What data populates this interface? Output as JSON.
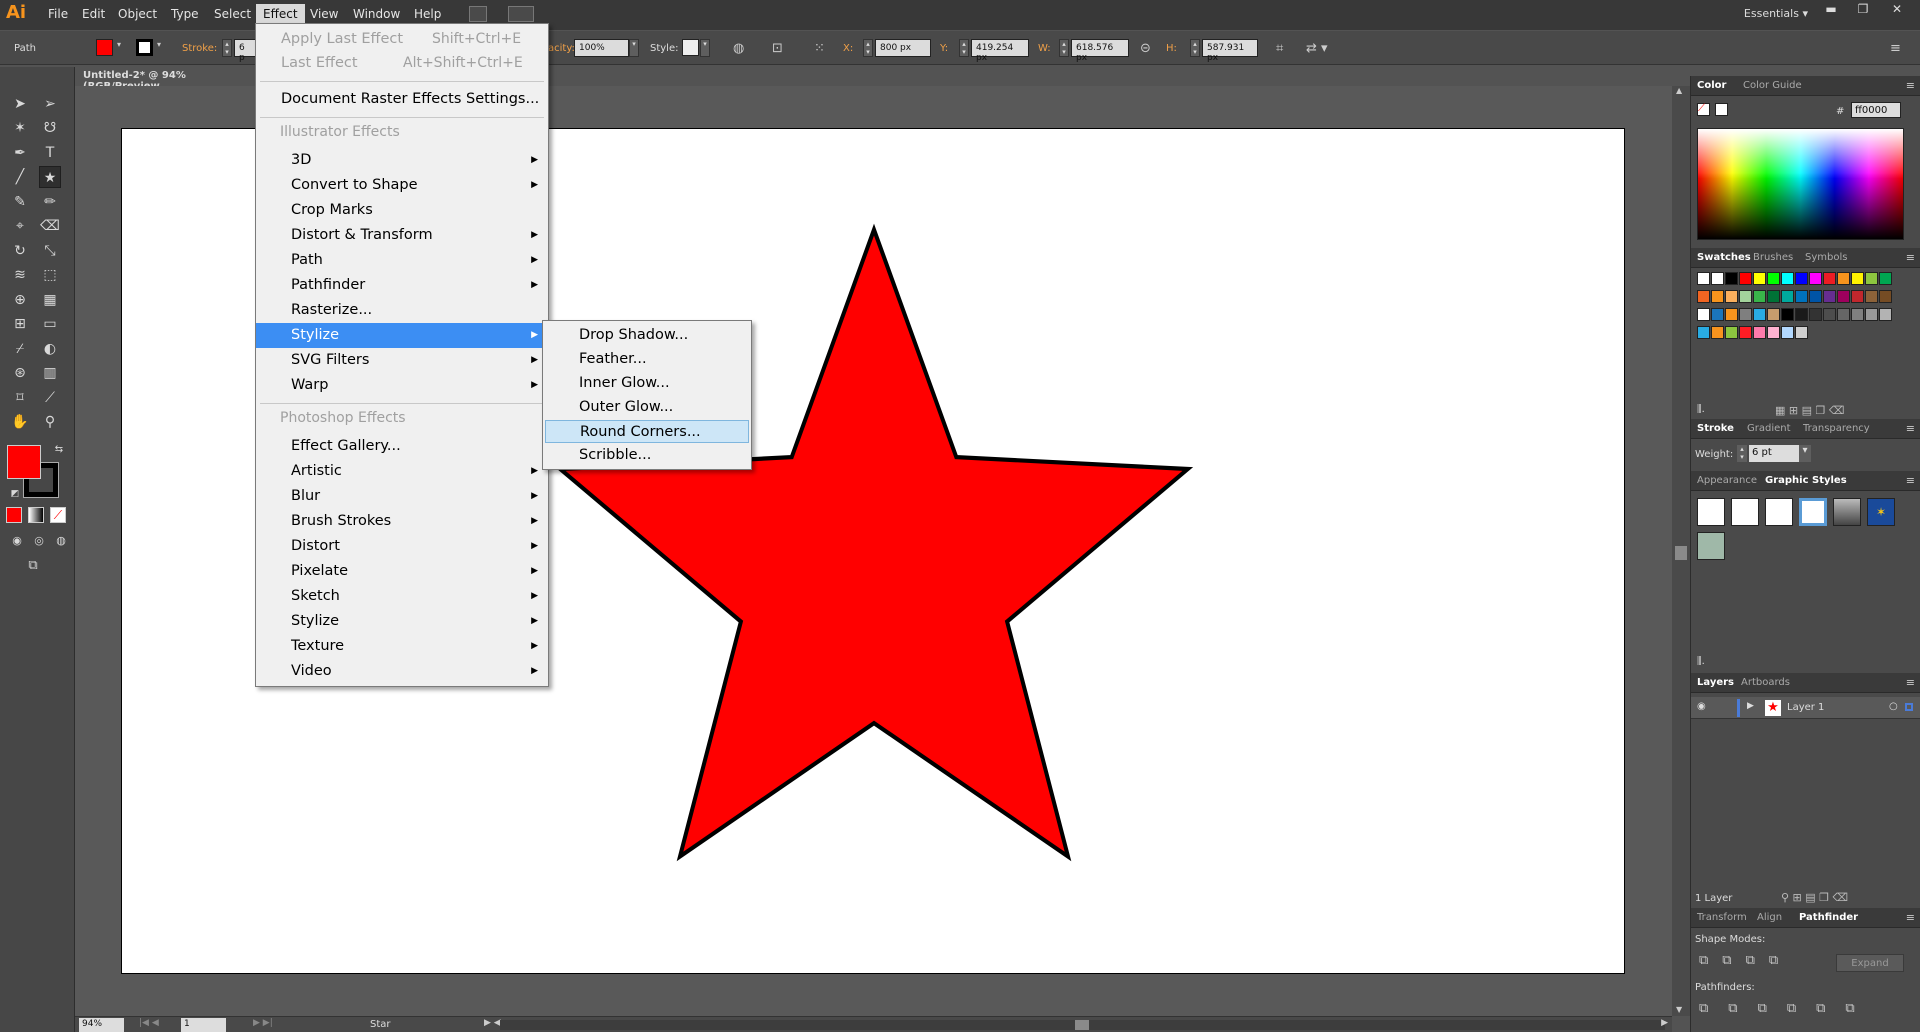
{
  "app": {
    "logo": "Ai",
    "workspace": "Essentials"
  },
  "menubar": [
    "File",
    "Edit",
    "Object",
    "Type",
    "Select",
    "Effect",
    "View",
    "Window",
    "Help"
  ],
  "control": {
    "selection_type": "Path",
    "stroke_label": "Stroke:",
    "stroke_value": "6 p",
    "opacity_label": "acity:",
    "opacity_value": "100%",
    "style_label": "Style:",
    "x_label": "X:",
    "x_value": "800 px",
    "y_label": "Y:",
    "y_value": "419.254 px",
    "w_label": "W:",
    "w_value": "618.576 px",
    "h_label": "H:",
    "h_value": "587.931 px"
  },
  "document": {
    "tab_title": "Untitled-2* @ 94% (RGB/Preview"
  },
  "effect_menu": {
    "items": [
      {
        "label": "Apply Last Effect",
        "shortcut": "Shift+Ctrl+E",
        "disabled": true
      },
      {
        "label": "Last Effect",
        "shortcut": "Alt+Shift+Ctrl+E",
        "disabled": true
      },
      {
        "label": "Document Raster Effects Settings..."
      }
    ],
    "illustrator_header": "Illustrator Effects",
    "illustrator_items": [
      "3D",
      "Convert to Shape",
      "Crop Marks",
      "Distort & Transform",
      "Path",
      "Pathfinder",
      "Rasterize...",
      "Stylize",
      "SVG Filters",
      "Warp"
    ],
    "photoshop_header": "Photoshop Effects",
    "photoshop_items": [
      "Effect Gallery...",
      "Artistic",
      "Blur",
      "Brush Strokes",
      "Distort",
      "Pixelate",
      "Sketch",
      "Stylize",
      "Texture",
      "Video"
    ]
  },
  "stylize_submenu": [
    "Drop Shadow...",
    "Feather...",
    "Inner Glow...",
    "Outer Glow...",
    "Round Corners...",
    "Scribble..."
  ],
  "panels": {
    "color_tabs": [
      "Color",
      "Color Guide"
    ],
    "hex_value": "ff0000",
    "swatch_tabs": [
      "Swatches",
      "Brushes",
      "Symbols"
    ],
    "stroke_tabs": [
      "Stroke",
      "Gradient",
      "Transparency"
    ],
    "weight_label": "Weight:",
    "weight_value": "6 pt",
    "appearance_tabs": [
      "Appearance",
      "Graphic Styles"
    ],
    "layer_tabs": [
      "Layers",
      "Artboards"
    ],
    "layer_name": "Layer 1",
    "layer_count": "1 Layer",
    "pathfinder_tabs": [
      "Transform",
      "Align",
      "Pathfinder"
    ],
    "shape_modes_label": "Shape Modes:",
    "expand_label": "Expand",
    "pathfinders_label": "Pathfinders:"
  },
  "status": {
    "zoom": "94%",
    "page": "1",
    "object_name": "Star"
  },
  "colors": {
    "fill": "#ff0000",
    "stroke": "#000000",
    "menu_highlight": "#3c8ef3"
  }
}
